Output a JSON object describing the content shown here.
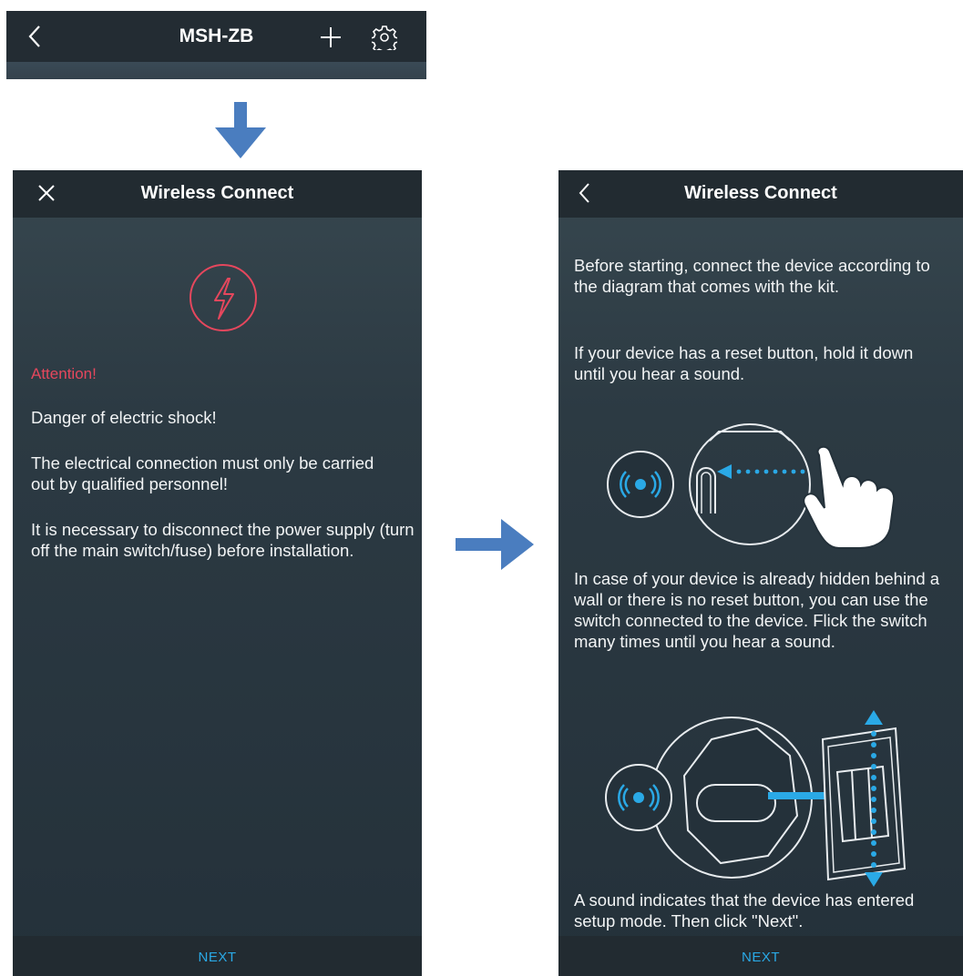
{
  "top_bar": {
    "title": "MSH-ZB",
    "icons": [
      "back-chevron-icon",
      "plus-icon",
      "gear-icon"
    ]
  },
  "left_screen": {
    "nav_title": "Wireless Connect",
    "nav_icon": "close-icon",
    "warning_icon": "lightning-icon",
    "attention": "Attention!",
    "danger": "Danger of electric shock!",
    "qualified": "The electrical connection must only be carried out by qualified personnel!",
    "disconnect": "It is necessary to disconnect the power supply (turn off the main switch/fuse) before installation.",
    "next_label": "NEXT"
  },
  "right_screen": {
    "nav_title": "Wireless Connect",
    "nav_icon": "back-chevron-icon",
    "para_connect": "Before starting, connect the device according to the diagram that comes with the kit.",
    "para_reset": "If your device has a reset button, hold it down until you hear a sound.",
    "para_hidden": "In case of your device is already hidden behind a wall or there is no reset button, you can use the switch connected to the device. Flick the switch many times until you hear a sound.",
    "para_sound": "A sound indicates that the device has entered setup mode. Then click \"Next\".",
    "next_label": "NEXT"
  },
  "colors": {
    "accent": "#2aa9e6",
    "attention": "#e5475d",
    "flow_arrow": "#4a7dbf"
  }
}
